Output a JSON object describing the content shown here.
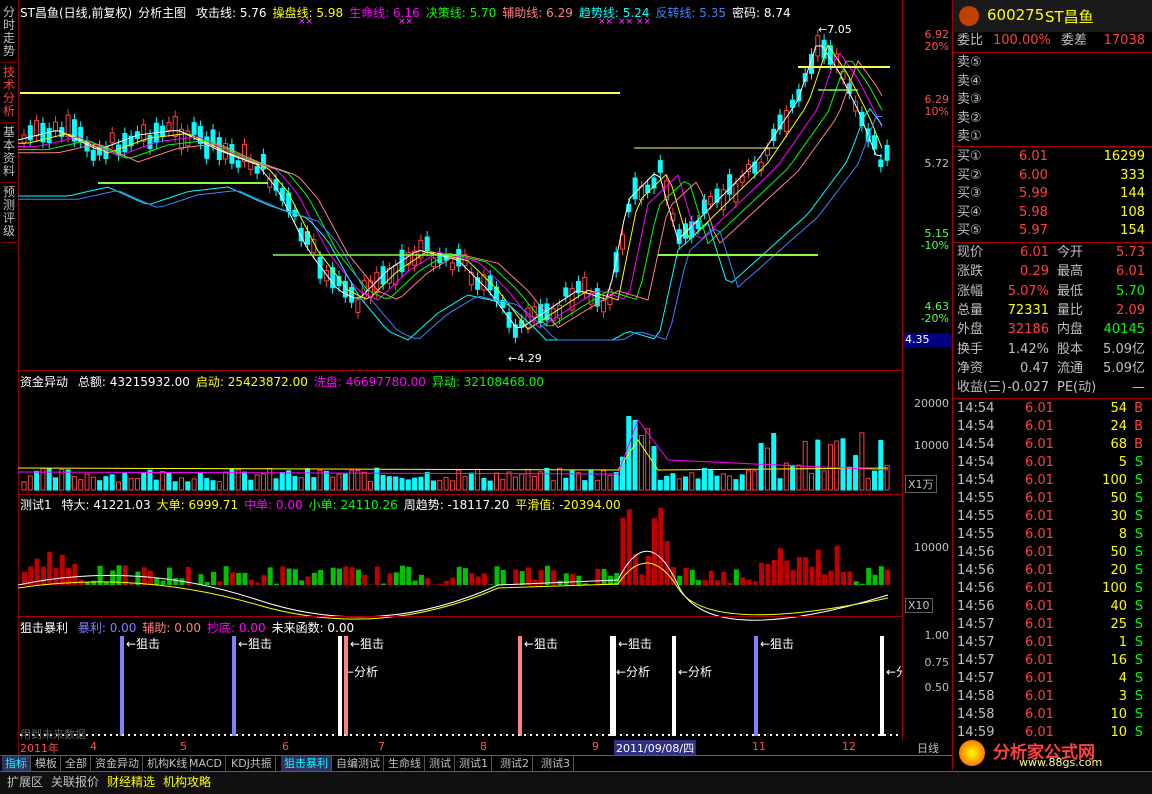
{
  "left_tabs": [
    {
      "label": "分时走势",
      "active": false
    },
    {
      "label": "技术分析",
      "active": true
    },
    {
      "label": "基本资料",
      "active": false
    },
    {
      "label": "预测评级",
      "active": false
    }
  ],
  "main_header": {
    "title": "ST昌鱼(日线,前复权)",
    "indicator": "分析主图",
    "items": [
      {
        "label": "攻击线:",
        "value": "5.76",
        "color": "#ffffff"
      },
      {
        "label": "操盘线:",
        "value": "5.98",
        "color": "#ffff00"
      },
      {
        "label": "生命线:",
        "value": "6.16",
        "color": "#ff00ff"
      },
      {
        "label": "决策线:",
        "value": "5.70",
        "color": "#00ff00"
      },
      {
        "label": "辅助线:",
        "value": "6.29",
        "color": "#ff8080"
      },
      {
        "label": "趋势线:",
        "value": "5.24",
        "color": "#00ffff"
      },
      {
        "label": "反转线:",
        "value": "5.35",
        "color": "#4080ff"
      },
      {
        "label": "密码:",
        "value": "8.74",
        "color": "#ffffff"
      }
    ]
  },
  "price_axis": {
    "ticks": [
      {
        "price": "6.92",
        "pct": "20%"
      },
      {
        "price": "6.29",
        "pct": "10%"
      },
      {
        "price": "5.72",
        "pct": ""
      },
      {
        "price": "5.15",
        "pct": "-10%"
      },
      {
        "price": "4.63",
        "pct": "-20%"
      }
    ],
    "current": "4.35",
    "high_label": "7.05",
    "low_label": "4.29"
  },
  "panel2": {
    "title": "资金异动",
    "items": [
      {
        "label": "总额:",
        "value": "43215932.00",
        "color": "#ffffff"
      },
      {
        "label": "启动:",
        "value": "25423872.00",
        "color": "#ffff00"
      },
      {
        "label": "洗盘:",
        "value": "46697780.00",
        "color": "#ff00ff"
      },
      {
        "label": "异动:",
        "value": "32108468.00",
        "color": "#00ff00"
      }
    ],
    "ticks": [
      "20000",
      "10000"
    ],
    "unit": "X1万"
  },
  "panel3": {
    "title": "测试1",
    "items": [
      {
        "label": "特大:",
        "value": "41221.03",
        "color": "#ffffff"
      },
      {
        "label": "大单:",
        "value": "6999.71",
        "color": "#ffff00"
      },
      {
        "label": "中单:",
        "value": "0.00",
        "color": "#ff00ff"
      },
      {
        "label": "小单:",
        "value": "24110.26",
        "color": "#00ff00"
      },
      {
        "label": "周趋势:",
        "value": "-18117.20",
        "color": "#ffffff"
      },
      {
        "label": "平滑值:",
        "value": "-20394.00",
        "color": "#ffff00"
      }
    ],
    "ticks": [
      "10000"
    ],
    "unit": "X10"
  },
  "panel4": {
    "title": "狙击暴利",
    "items": [
      {
        "label": "暴利:",
        "value": "0.00",
        "color": "#8080ff"
      },
      {
        "label": "辅助:",
        "value": "0.00",
        "color": "#ff8080"
      },
      {
        "label": "抄底:",
        "value": "0.00",
        "color": "#ff00ff"
      },
      {
        "label": "未来函数:",
        "value": "0.00",
        "color": "#ffffff"
      }
    ],
    "ticks": [
      "1.00",
      "0.75",
      "0.50"
    ],
    "signal_jiji": "←狙击",
    "signal_fenxi": "←分析",
    "footnote": "用到未来数据"
  },
  "x_axis": {
    "labels": [
      "2011年",
      "4",
      "5",
      "6",
      "7",
      "8",
      "9",
      "2011/09/08/四",
      "11",
      "12"
    ],
    "period": "日线"
  },
  "quote": {
    "code": "600275",
    "name": "ST昌鱼",
    "weibi_label": "委比",
    "weibi": "100.00%",
    "weicha_label": "委差",
    "weicha": "17038",
    "sells": [
      "卖⑤",
      "卖④",
      "卖③",
      "卖②",
      "卖①"
    ],
    "buys": [
      {
        "label": "买①",
        "price": "6.01",
        "vol": "16299"
      },
      {
        "label": "买②",
        "price": "6.00",
        "vol": "333"
      },
      {
        "label": "买③",
        "price": "5.99",
        "vol": "144"
      },
      {
        "label": "买④",
        "price": "5.98",
        "vol": "108"
      },
      {
        "label": "买⑤",
        "price": "5.97",
        "vol": "154"
      }
    ],
    "stats": [
      {
        "l1": "现价",
        "v1": "6.01",
        "l2": "今开",
        "v2": "5.73"
      },
      {
        "l1": "涨跌",
        "v1": "0.29",
        "l2": "最高",
        "v2": "6.01"
      },
      {
        "l1": "涨幅",
        "v1": "5.07%",
        "l2": "最低",
        "v2": "5.70"
      },
      {
        "l1": "总量",
        "v1": "72331",
        "l2": "量比",
        "v2": "2.09"
      },
      {
        "l1": "外盘",
        "v1": "32186",
        "l2": "内盘",
        "v2": "40145"
      },
      {
        "l1": "换手",
        "v1": "1.42%",
        "l2": "股本",
        "v2": "5.09亿"
      },
      {
        "l1": "净资",
        "v1": "0.47",
        "l2": "流通",
        "v2": "5.09亿"
      },
      {
        "l1": "收益(三)",
        "v1": "-0.027",
        "l2": "PE(动)",
        "v2": "—"
      }
    ],
    "ticks": [
      {
        "time": "14:54",
        "price": "6.01",
        "vol": "54",
        "dir": "B"
      },
      {
        "time": "14:54",
        "price": "6.01",
        "vol": "24",
        "dir": "B"
      },
      {
        "time": "14:54",
        "price": "6.01",
        "vol": "68",
        "dir": "B"
      },
      {
        "time": "14:54",
        "price": "6.01",
        "vol": "5",
        "dir": "S"
      },
      {
        "time": "14:54",
        "price": "6.01",
        "vol": "100",
        "dir": "S"
      },
      {
        "time": "14:55",
        "price": "6.01",
        "vol": "50",
        "dir": "S"
      },
      {
        "time": "14:55",
        "price": "6.01",
        "vol": "30",
        "dir": "S"
      },
      {
        "time": "14:55",
        "price": "6.01",
        "vol": "8",
        "dir": "S"
      },
      {
        "time": "14:56",
        "price": "6.01",
        "vol": "50",
        "dir": "S"
      },
      {
        "time": "14:56",
        "price": "6.01",
        "vol": "20",
        "dir": "S"
      },
      {
        "time": "14:56",
        "price": "6.01",
        "vol": "100",
        "dir": "S"
      },
      {
        "time": "14:56",
        "price": "6.01",
        "vol": "40",
        "dir": "S"
      },
      {
        "time": "14:57",
        "price": "6.01",
        "vol": "25",
        "dir": "S"
      },
      {
        "time": "14:57",
        "price": "6.01",
        "vol": "1",
        "dir": "S"
      },
      {
        "time": "14:57",
        "price": "6.01",
        "vol": "16",
        "dir": "S"
      },
      {
        "time": "14:57",
        "price": "6.01",
        "vol": "4",
        "dir": "S"
      },
      {
        "time": "14:58",
        "price": "6.01",
        "vol": "3",
        "dir": "S"
      },
      {
        "time": "14:58",
        "price": "6.01",
        "vol": "10",
        "dir": "S"
      },
      {
        "time": "14:59",
        "price": "6.01",
        "vol": "10",
        "dir": "S"
      }
    ]
  },
  "bottom_tabs": [
    {
      "label": "指标",
      "active": true
    },
    {
      "label": "模板",
      "active": false
    },
    {
      "label": "全部",
      "active": false
    },
    {
      "label": "资金异动",
      "active": false
    },
    {
      "label": "机构K线",
      "active": false
    },
    {
      "label": "MACD",
      "active": false
    },
    {
      "label": "KDJ共振",
      "active": false
    },
    {
      "label": "狙击暴利",
      "active": true
    },
    {
      "label": "自编测试",
      "active": false
    },
    {
      "label": "生命线",
      "active": false
    },
    {
      "label": "测试",
      "active": false
    },
    {
      "label": "测试1",
      "active": false
    },
    {
      "label": "测试2",
      "active": false
    },
    {
      "label": "测试3",
      "active": false
    }
  ],
  "status_tabs": [
    "扩展区",
    "关联报价",
    "财经精选",
    "机构攻略"
  ],
  "watermark": {
    "brand": "分析家公式网",
    "url": "www.88gs.com"
  },
  "colors": {
    "up": "#ff4040",
    "down": "#00ffff",
    "border": "#a00000"
  }
}
